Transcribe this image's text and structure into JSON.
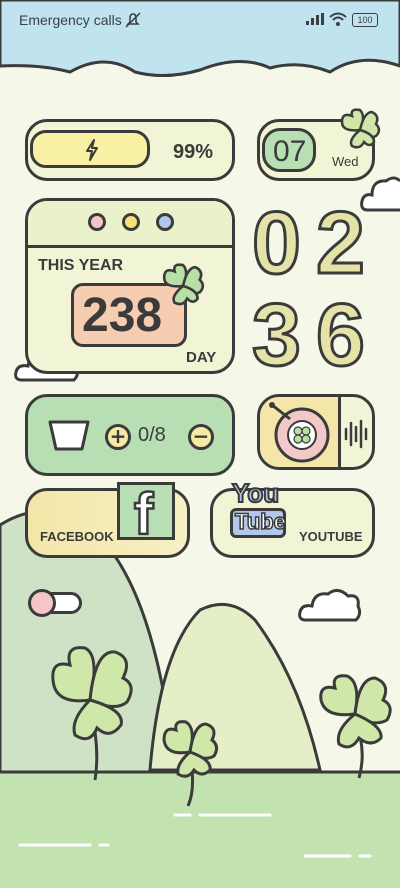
{
  "status_bar": {
    "carrier": "Emergency calls",
    "battery": "100"
  },
  "battery_widget": {
    "percent": "99%",
    "level": 0.99
  },
  "date_widget": {
    "day": "07",
    "weekday": "Wed"
  },
  "year_widget": {
    "heading": "THIS YEAR",
    "count": "238",
    "unit": "DAY"
  },
  "clock": {
    "hour_tens": "0",
    "hour_ones": "2",
    "min_tens": "3",
    "min_ones": "6"
  },
  "water_widget": {
    "value": "0/8"
  },
  "facebook": {
    "label": "FACEBOOK",
    "logo": "f"
  },
  "youtube": {
    "label": "YOUTUBE",
    "logo_top": "You",
    "logo_bottom": "Tube"
  }
}
